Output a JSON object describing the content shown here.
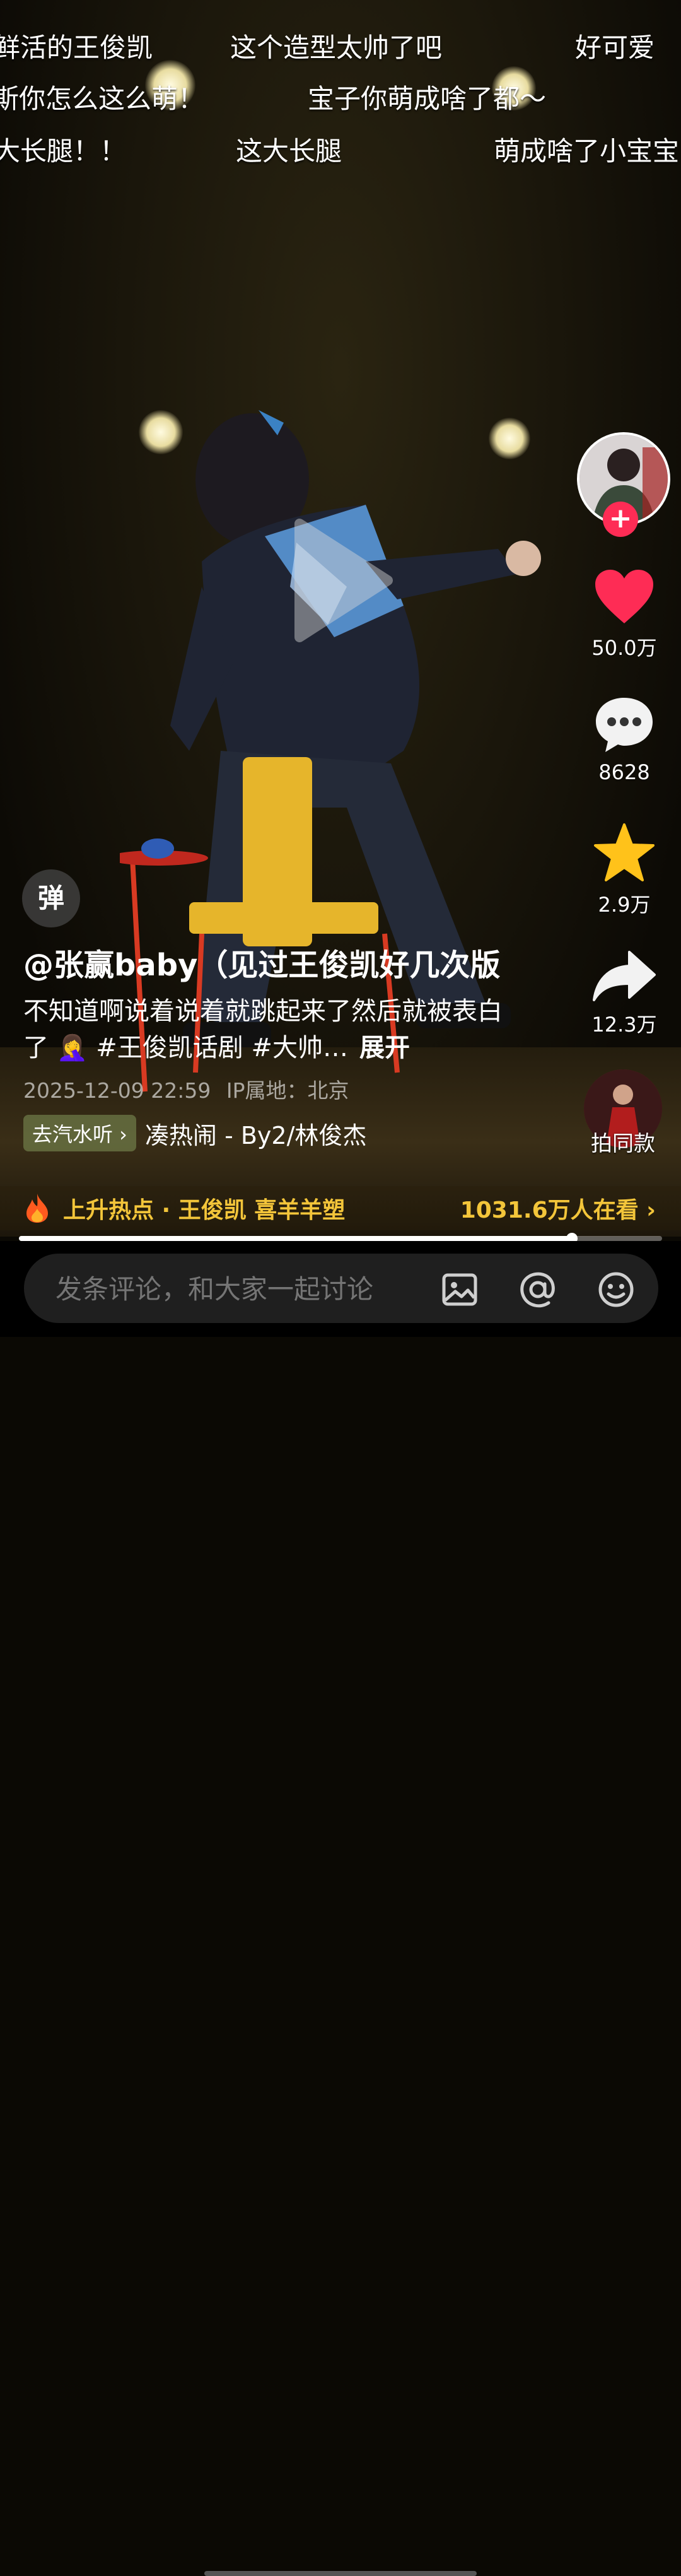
{
  "danmaku": [
    {
      "text": "鲜活的王俊凯"
    },
    {
      "text": "这个造型太帅了吧"
    },
    {
      "text": "好可爱"
    },
    {
      "text": "斯你怎么这么萌！"
    },
    {
      "text": "宝子你萌成啥了都～"
    },
    {
      "text": "大长腿！！"
    },
    {
      "text": "这大长腿"
    },
    {
      "text": "萌成啥了小宝宝"
    }
  ],
  "rail": {
    "likes": "50.0万",
    "comments": "8628",
    "favorites": "2.9万",
    "shares": "12.3万",
    "follow_plus": "+"
  },
  "danmu_toggle": "弹",
  "author": "@张赢baby（见过王俊凯好几次版",
  "caption": {
    "text": "不知道啊说着说着就跳起来了然后就被表白了 🤦‍♀️ #王俊凯话剧 #大帅…",
    "more": "展开"
  },
  "meta": {
    "datetime": "2025-12-09 22:59",
    "ip": "IP属地：北京"
  },
  "music": {
    "badge": "去汽水听 ›",
    "name": "凑热闹 - By2/林俊杰"
  },
  "same_style": "拍同款",
  "hotspot": {
    "text": "上升热点 · 王俊凯 喜羊羊塑",
    "viewers": "1031.6万人在看 ›"
  },
  "progress": 0.86,
  "comment": {
    "placeholder": "发条评论，和大家一起讨论"
  },
  "colors": {
    "like": "#fe2c55",
    "favorite": "#ffc21a",
    "hot": "#f3c53a"
  }
}
